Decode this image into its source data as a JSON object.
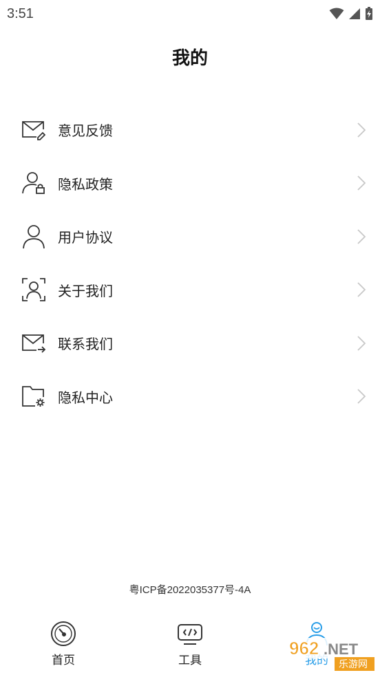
{
  "status_bar": {
    "time": "3:51"
  },
  "header": {
    "title": "我的"
  },
  "menu": {
    "items": [
      {
        "label": "意见反馈",
        "icon": "mail-edit-icon"
      },
      {
        "label": "隐私政策",
        "icon": "user-lock-icon"
      },
      {
        "label": "用户协议",
        "icon": "user-icon"
      },
      {
        "label": "关于我们",
        "icon": "user-scan-icon"
      },
      {
        "label": "联系我们",
        "icon": "mail-send-icon"
      },
      {
        "label": "隐私中心",
        "icon": "folder-settings-icon"
      }
    ]
  },
  "footer": {
    "icp": "粤ICP备2022035377号-4A"
  },
  "bottom_nav": {
    "tabs": [
      {
        "label": "首页",
        "icon": "speedometer-icon"
      },
      {
        "label": "工具",
        "icon": "code-window-icon"
      },
      {
        "label": "我的",
        "icon": "profile-icon"
      }
    ]
  },
  "watermark": {
    "brand": "962.NET",
    "sub": "乐游网"
  },
  "colors": {
    "accent": "#2a9ee8",
    "icon": "#333333",
    "chevron": "#c8c8c8"
  }
}
